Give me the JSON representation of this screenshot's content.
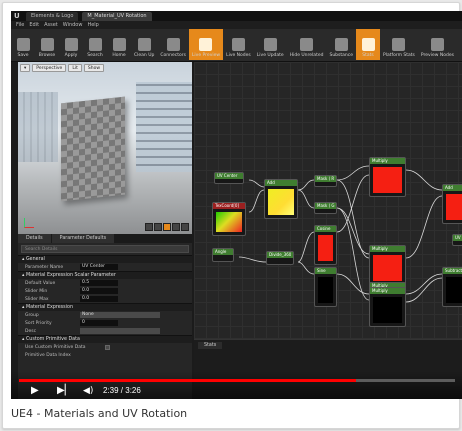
{
  "caption": "UE4 - Materials and UV Rotation",
  "editor": {
    "tabs": [
      "Elements & Logo",
      "M_Material_UV Rotation"
    ],
    "menu": [
      "File",
      "Edit",
      "Asset",
      "Window",
      "Help"
    ],
    "toolbar": [
      "Save",
      "Browse",
      "Apply",
      "Search",
      "Home",
      "Clean Up",
      "Connectors",
      "Live Preview",
      "Live Nodes",
      "Live Update",
      "Hide Unrelated",
      "Substance",
      "Stats",
      "Platform Stats",
      "Preview Nodes"
    ],
    "toolbar_highlighted": [
      "Live Preview",
      "Stats"
    ],
    "viewport": {
      "buttons": [
        "Perspective",
        "Lit",
        "Show"
      ]
    },
    "details": {
      "tabs": [
        "Details",
        "Parameter Defaults"
      ],
      "search_placeholder": "Search Details",
      "sections": {
        "general": {
          "title": "General",
          "parameter_name_label": "Parameter Name",
          "parameter_name": "UV Center"
        },
        "scalar": {
          "title": "Material Expression Scalar Parameter",
          "default_value_label": "Default Value",
          "default_value": "0.5",
          "slider_min_label": "Slider Min",
          "slider_min": "0.0",
          "slider_max_label": "Slider Max",
          "slider_max": "0.0"
        },
        "expression": {
          "title": "Material Expression",
          "group_label": "Group",
          "group": "None",
          "sort_priority_label": "Sort Priority",
          "sort_priority": "0",
          "desc_label": "Desc"
        },
        "custom": {
          "title": "Custom Primitive Data",
          "use_label": "Use Custom Primitive Data",
          "index_label": "Primitive Data Index"
        }
      }
    },
    "graph": {
      "nodes": [
        {
          "title": "UV Center",
          "color": "#3f7d30"
        },
        {
          "title": "TexCoord[0]",
          "color": "#9b2020"
        },
        {
          "title": "Add",
          "color": "#3f7d30"
        },
        {
          "title": "Angle",
          "color": "#3f7d30"
        },
        {
          "title": "Divide_360",
          "color": "#3f7d30"
        },
        {
          "title": "Mask ( R )",
          "color": "#3f7d30"
        },
        {
          "title": "Mask ( G )",
          "color": "#3f7d30"
        },
        {
          "title": "Cosine",
          "color": "#3f7d30"
        },
        {
          "title": "Sine",
          "color": "#3f7d30"
        },
        {
          "title": "Multiply",
          "color": "#3f7d30"
        },
        {
          "title": "Multiply",
          "color": "#3f7d30"
        },
        {
          "title": "Multiply",
          "color": "#3f7d30"
        },
        {
          "title": "Multiply",
          "color": "#3f7d30"
        },
        {
          "title": "Add",
          "color": "#3f7d30"
        },
        {
          "title": "Subtract",
          "color": "#3f7d30"
        },
        {
          "title": "UV Center",
          "color": "#3f7d30"
        }
      ]
    },
    "stats_tab": "Stats"
  },
  "player": {
    "time": "2:39 / 3:26",
    "progress": 0.772
  }
}
